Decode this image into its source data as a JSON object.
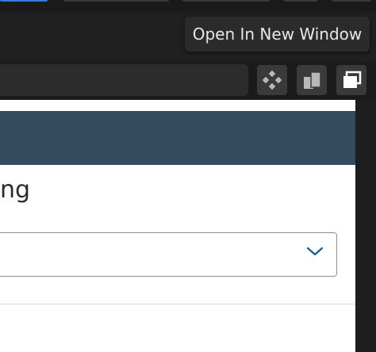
{
  "tooltip": {
    "text": "Open In New Window"
  },
  "toolbar": {
    "buttons": [
      {
        "icon": "move-icon"
      },
      {
        "icon": "duplicate-icon"
      },
      {
        "icon": "open-in-new-window-icon"
      }
    ]
  },
  "page": {
    "heading_fragment": "ng",
    "dropdown": {
      "selected_value": ""
    }
  },
  "colors": {
    "banner": "#344a5e",
    "active_tab": "#2f7de1",
    "chevron": "#0a5ea8"
  }
}
